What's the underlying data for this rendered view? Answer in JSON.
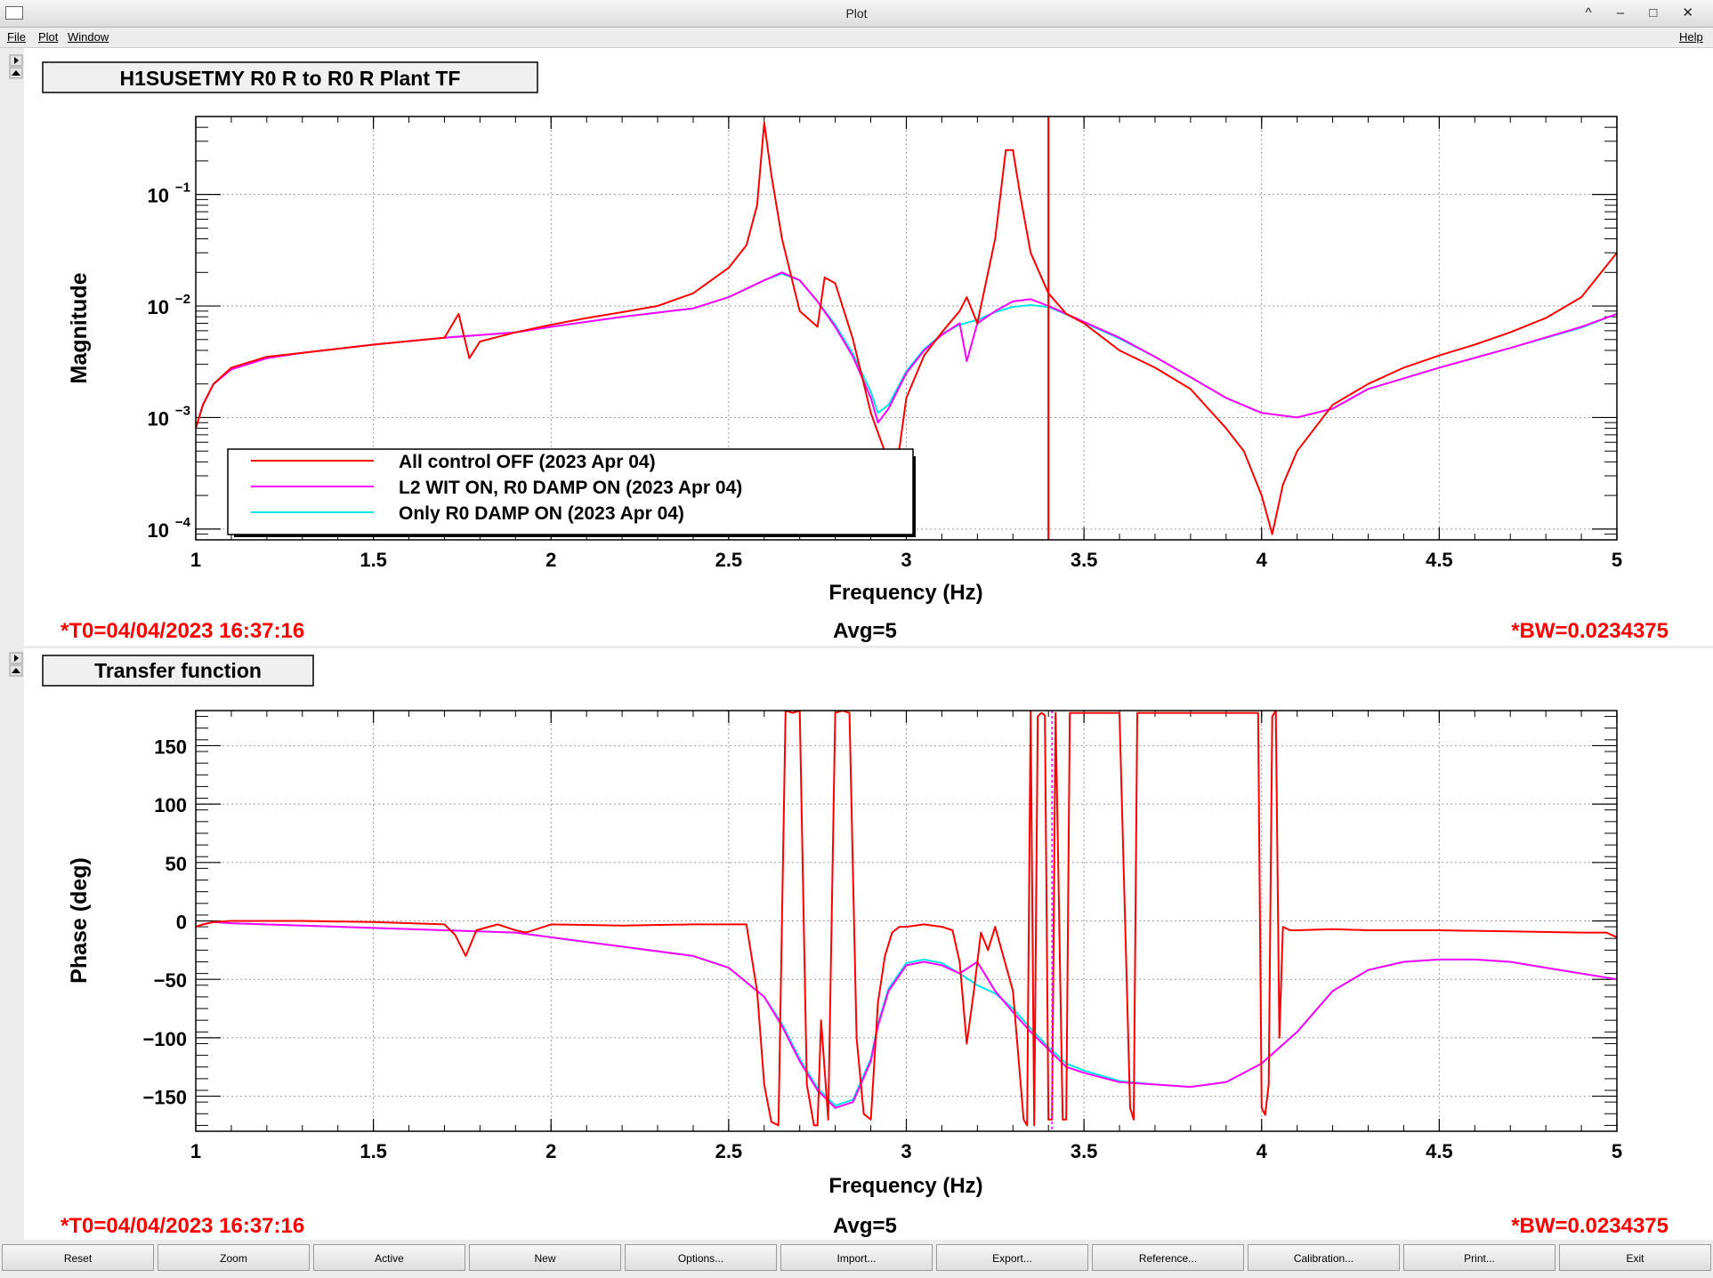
{
  "window": {
    "title": "Plot",
    "controls": "^ – □ ✕"
  },
  "menu": {
    "file": "File",
    "plot": "Plot",
    "window": "Window",
    "help": "Help"
  },
  "panels": [
    {
      "tab_label": "H1SUSETMY R0 R to R0 R Plant TF",
      "t0": "*T0=04/04/2023 16:37:16",
      "avg": "Avg=5",
      "bw": "*BW=0.0234375"
    },
    {
      "tab_label": "Transfer function",
      "t0": "*T0=04/04/2023 16:37:16",
      "avg": "Avg=5",
      "bw": "*BW=0.0234375"
    }
  ],
  "buttons": [
    "Reset",
    "Zoom",
    "Active",
    "New",
    "Options...",
    "Import...",
    "Export...",
    "Reference...",
    "Calibration...",
    "Print...",
    "Exit"
  ],
  "colors": {
    "red": "#ff0000",
    "magenta": "#ff00ff",
    "cyan": "#00e5e5"
  },
  "chart_data": [
    {
      "type": "line",
      "xlabel": "Frequency (Hz)",
      "ylabel": "Magnitude",
      "xscale": "linear",
      "yscale": "log",
      "xlim": [
        1,
        5
      ],
      "ylim": [
        8e-05,
        0.5
      ],
      "grid": true,
      "legend_position": "bottom-left",
      "x_ticks": [
        {
          "v": 1,
          "label": "1"
        },
        {
          "v": 1.5,
          "label": "1.5"
        },
        {
          "v": 2,
          "label": "2"
        },
        {
          "v": 2.5,
          "label": "2.5"
        },
        {
          "v": 3,
          "label": "3"
        },
        {
          "v": 3.5,
          "label": "3.5"
        },
        {
          "v": 4,
          "label": "4"
        },
        {
          "v": 4.5,
          "label": "4.5"
        },
        {
          "v": 5,
          "label": "5"
        }
      ],
      "y_ticks": [
        {
          "v": 0.1,
          "base": "10",
          "exp": "−1"
        },
        {
          "v": 0.01,
          "base": "10",
          "exp": "−2"
        },
        {
          "v": 0.001,
          "base": "10",
          "exp": "−3"
        },
        {
          "v": 0.0001,
          "base": "10",
          "exp": "−4"
        }
      ],
      "cursor_x": 3.4,
      "series": [
        {
          "name": "All control OFF (2023 Apr 04)",
          "color": "#ff0000",
          "x": [
            1,
            1.02,
            1.05,
            1.1,
            1.2,
            1.3,
            1.5,
            1.7,
            1.74,
            1.77,
            1.8,
            1.9,
            2,
            2.1,
            2.2,
            2.3,
            2.4,
            2.5,
            2.55,
            2.58,
            2.6,
            2.62,
            2.65,
            2.7,
            2.75,
            2.77,
            2.8,
            2.85,
            2.9,
            2.95,
            2.97,
            3,
            3.05,
            3.1,
            3.15,
            3.17,
            3.2,
            3.25,
            3.28,
            3.3,
            3.32,
            3.35,
            3.4,
            3.45,
            3.5,
            3.6,
            3.7,
            3.8,
            3.9,
            3.95,
            4,
            4.03,
            4.06,
            4.1,
            4.2,
            4.3,
            4.4,
            4.5,
            4.6,
            4.7,
            4.8,
            4.9,
            5
          ],
          "values": [
            0.0008,
            0.0013,
            0.002,
            0.0028,
            0.0035,
            0.0038,
            0.0045,
            0.0052,
            0.0085,
            0.0034,
            0.0048,
            0.0058,
            0.0068,
            0.0078,
            0.0088,
            0.01,
            0.013,
            0.022,
            0.035,
            0.08,
            0.44,
            0.15,
            0.04,
            0.009,
            0.0065,
            0.018,
            0.016,
            0.005,
            0.0011,
            0.0004,
            0.0003,
            0.0015,
            0.0036,
            0.0058,
            0.009,
            0.012,
            0.007,
            0.04,
            0.25,
            0.25,
            0.1,
            0.03,
            0.013,
            0.0085,
            0.007,
            0.004,
            0.0028,
            0.0018,
            0.0008,
            0.0005,
            0.0002,
            9e-05,
            0.00025,
            0.0005,
            0.0013,
            0.002,
            0.0028,
            0.0036,
            0.0045,
            0.0058,
            0.0078,
            0.012,
            0.03
          ]
        },
        {
          "name": "L2 WIT ON, R0 DAMP ON (2023 Apr 04)",
          "color": "#ff00ff",
          "x": [
            1,
            1.02,
            1.05,
            1.1,
            1.2,
            1.3,
            1.5,
            1.7,
            1.9,
            2,
            2.2,
            2.4,
            2.5,
            2.6,
            2.65,
            2.7,
            2.75,
            2.8,
            2.85,
            2.9,
            2.92,
            2.95,
            3,
            3.05,
            3.1,
            3.15,
            3.17,
            3.2,
            3.25,
            3.3,
            3.35,
            3.4,
            3.45,
            3.5,
            3.6,
            3.7,
            3.8,
            3.9,
            4,
            4.1,
            4.2,
            4.3,
            4.5,
            4.7,
            4.9,
            5
          ],
          "values": [
            0.0008,
            0.0013,
            0.002,
            0.0027,
            0.0034,
            0.0038,
            0.0045,
            0.0052,
            0.0058,
            0.0065,
            0.008,
            0.0095,
            0.012,
            0.017,
            0.02,
            0.017,
            0.011,
            0.0065,
            0.0035,
            0.0015,
            0.0009,
            0.0012,
            0.0025,
            0.004,
            0.0055,
            0.007,
            0.0032,
            0.007,
            0.009,
            0.011,
            0.0115,
            0.01,
            0.0085,
            0.0072,
            0.0052,
            0.0035,
            0.0023,
            0.0015,
            0.0011,
            0.001,
            0.0012,
            0.0018,
            0.0028,
            0.0042,
            0.0065,
            0.0085
          ]
        },
        {
          "name": "Only R0 DAMP ON (2023 Apr 04)",
          "color": "#00e5e5",
          "x": [
            1,
            1.02,
            1.05,
            1.1,
            1.2,
            1.3,
            1.5,
            1.7,
            1.9,
            2,
            2.2,
            2.4,
            2.5,
            2.6,
            2.65,
            2.7,
            2.75,
            2.8,
            2.85,
            2.9,
            2.92,
            2.95,
            3,
            3.05,
            3.1,
            3.15,
            3.2,
            3.25,
            3.3,
            3.35,
            3.4,
            3.45,
            3.5,
            3.6,
            3.7,
            3.8,
            3.9,
            4,
            4.1,
            4.2,
            4.3,
            4.5,
            4.7,
            4.9,
            5
          ],
          "values": [
            0.0008,
            0.0013,
            0.002,
            0.0027,
            0.0035,
            0.0038,
            0.0045,
            0.0052,
            0.0058,
            0.0065,
            0.008,
            0.0095,
            0.012,
            0.017,
            0.0195,
            0.017,
            0.011,
            0.0068,
            0.0037,
            0.0017,
            0.0011,
            0.0013,
            0.0026,
            0.0041,
            0.0056,
            0.0068,
            0.0075,
            0.0088,
            0.0098,
            0.0102,
            0.0098,
            0.0084,
            0.0071,
            0.0051,
            0.0035,
            0.0023,
            0.0015,
            0.0011,
            0.001,
            0.0012,
            0.0018,
            0.0028,
            0.0042,
            0.0064,
            0.0085
          ]
        }
      ]
    },
    {
      "type": "line",
      "xlabel": "Frequency (Hz)",
      "ylabel": "Phase (deg)",
      "xscale": "linear",
      "yscale": "linear",
      "xlim": [
        1,
        5
      ],
      "ylim": [
        -180,
        180
      ],
      "grid": true,
      "x_ticks": [
        {
          "v": 1,
          "label": "1"
        },
        {
          "v": 1.5,
          "label": "1.5"
        },
        {
          "v": 2,
          "label": "2"
        },
        {
          "v": 2.5,
          "label": "2.5"
        },
        {
          "v": 3,
          "label": "3"
        },
        {
          "v": 3.5,
          "label": "3.5"
        },
        {
          "v": 4,
          "label": "4"
        },
        {
          "v": 4.5,
          "label": "4.5"
        },
        {
          "v": 5,
          "label": "5"
        }
      ],
      "y_ticks": [
        {
          "v": 150,
          "label": "150"
        },
        {
          "v": 100,
          "label": "100"
        },
        {
          "v": 50,
          "label": "50"
        },
        {
          "v": 0,
          "label": "0"
        },
        {
          "v": -50,
          "label": "−50"
        },
        {
          "v": -100,
          "label": "−100"
        },
        {
          "v": -150,
          "label": "−150"
        }
      ],
      "cursor_x": 3.41,
      "series": [
        {
          "name": "All control OFF (2023 Apr 04)",
          "color": "#ff0000",
          "x": [
            1,
            1.02,
            1.05,
            1.1,
            1.3,
            1.5,
            1.7,
            1.73,
            1.76,
            1.79,
            1.85,
            1.9,
            1.93,
            2,
            2.2,
            2.4,
            2.55,
            2.58,
            2.6,
            2.62,
            2.64,
            2.66,
            2.68,
            2.7,
            2.72,
            2.74,
            2.75,
            2.76,
            2.78,
            2.8,
            2.82,
            2.84,
            2.86,
            2.88,
            2.9,
            2.92,
            2.94,
            2.96,
            2.98,
            3,
            3.05,
            3.1,
            3.13,
            3.15,
            3.17,
            3.19,
            3.21,
            3.23,
            3.25,
            3.3,
            3.33,
            3.34,
            3.35,
            3.36,
            3.37,
            3.38,
            3.39,
            3.4,
            3.41,
            3.42,
            3.44,
            3.45,
            3.46,
            3.47,
            3.48,
            3.5,
            3.6,
            3.63,
            3.64,
            3.65,
            3.66,
            3.7,
            3.8,
            3.9,
            3.99,
            4,
            4.01,
            4.02,
            4.03,
            4.04,
            4.05,
            4.06,
            4.08,
            4.1,
            4.2,
            4.3,
            4.5,
            4.7,
            4.9,
            4.97,
            5
          ],
          "values": [
            -5,
            -3,
            -1,
            0,
            0,
            -1,
            -3,
            -12,
            -30,
            -8,
            -3,
            -8,
            -10,
            -3,
            -4,
            -3,
            -3,
            -60,
            -140,
            -172,
            -175,
            180,
            178,
            180,
            -140,
            -175,
            -175,
            -85,
            -170,
            178,
            180,
            178,
            -100,
            -165,
            -170,
            -70,
            -30,
            -10,
            -5,
            -5,
            -3,
            -5,
            -8,
            -35,
            -105,
            -60,
            -10,
            -25,
            -5,
            -60,
            -170,
            -175,
            180,
            -175,
            175,
            178,
            176,
            -170,
            -170,
            178,
            -170,
            -170,
            178,
            178,
            178,
            178,
            178,
            -160,
            -170,
            178,
            178,
            178,
            178,
            178,
            178,
            -160,
            -166,
            -140,
            175,
            180,
            -100,
            -5,
            -8,
            -8,
            -7,
            -8,
            -8,
            -9,
            -10,
            -10,
            -14
          ]
        },
        {
          "name": "L2 WIT ON, R0 DAMP ON (2023 Apr 04)",
          "color": "#ff00ff",
          "x": [
            1,
            1.02,
            1.05,
            1.1,
            1.3,
            1.5,
            1.7,
            1.9,
            2,
            2.2,
            2.4,
            2.5,
            2.6,
            2.65,
            2.7,
            2.75,
            2.8,
            2.85,
            2.9,
            2.92,
            2.95,
            3,
            3.05,
            3.1,
            3.15,
            3.2,
            3.25,
            3.3,
            3.35,
            3.4,
            3.45,
            3.5,
            3.6,
            3.7,
            3.8,
            3.9,
            4,
            4.1,
            4.2,
            4.3,
            4.4,
            4.5,
            4.6,
            4.7,
            4.8,
            4.9,
            5
          ],
          "values": [
            -5,
            -3,
            -1,
            -2,
            -4,
            -6,
            -8,
            -10,
            -14,
            -22,
            -30,
            -40,
            -65,
            -90,
            -120,
            -145,
            -160,
            -155,
            -120,
            -90,
            -60,
            -38,
            -35,
            -38,
            -45,
            -35,
            -60,
            -78,
            -95,
            -110,
            -125,
            -130,
            -138,
            -140,
            -142,
            -138,
            -122,
            -95,
            -60,
            -42,
            -35,
            -33,
            -33,
            -35,
            -40,
            -45,
            -50
          ]
        },
        {
          "name": "Only R0 DAMP ON (2023 Apr 04)",
          "color": "#00e5e5",
          "x": [
            1,
            1.02,
            1.05,
            1.1,
            1.3,
            1.5,
            1.7,
            1.9,
            2,
            2.2,
            2.4,
            2.5,
            2.6,
            2.65,
            2.7,
            2.75,
            2.8,
            2.85,
            2.9,
            2.92,
            2.95,
            3,
            3.05,
            3.1,
            3.15,
            3.2,
            3.25,
            3.3,
            3.35,
            3.4,
            3.45,
            3.5,
            3.6,
            3.7,
            3.8,
            3.9,
            4,
            4.1,
            4.2,
            4.3,
            4.4,
            4.5,
            4.6,
            4.7,
            4.8,
            4.9,
            5
          ],
          "values": [
            -5,
            -3,
            -1,
            -2,
            -4,
            -6,
            -8,
            -10,
            -14,
            -22,
            -30,
            -40,
            -65,
            -88,
            -118,
            -143,
            -158,
            -153,
            -118,
            -88,
            -58,
            -36,
            -33,
            -36,
            -45,
            -55,
            -62,
            -75,
            -92,
            -108,
            -122,
            -128,
            -137,
            -140,
            -142,
            -138,
            -122,
            -95,
            -60,
            -42,
            -35,
            -33,
            -33,
            -35,
            -40,
            -45,
            -50
          ]
        }
      ]
    }
  ]
}
